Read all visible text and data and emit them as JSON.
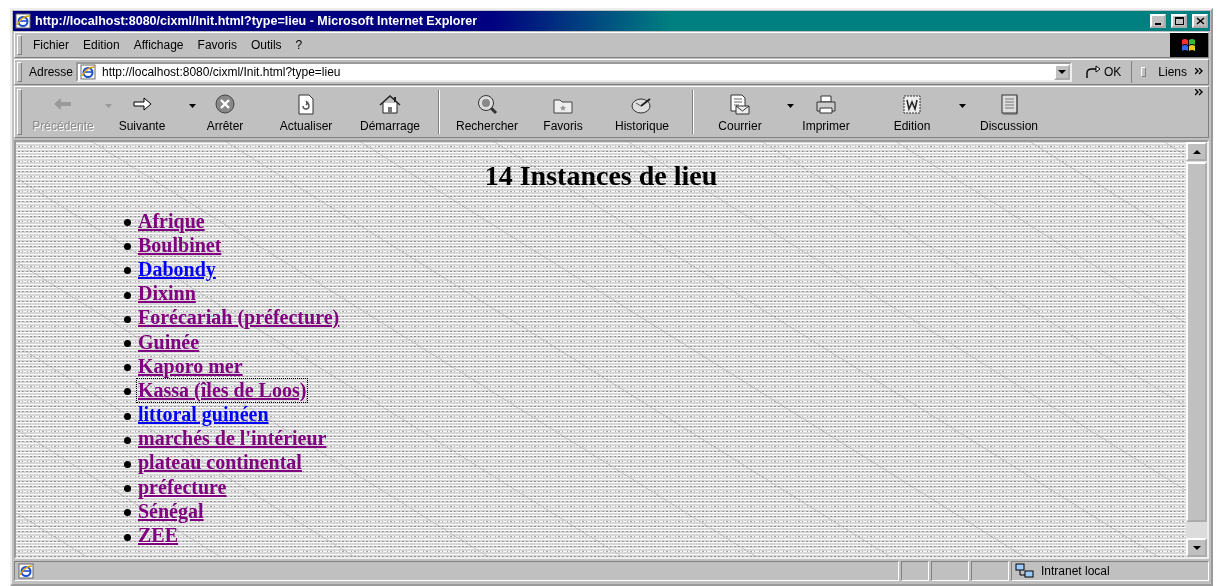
{
  "window": {
    "title": "http://localhost:8080/cixml/Init.html?type=lieu - Microsoft Internet Explorer"
  },
  "menu": [
    {
      "label": "Fichier"
    },
    {
      "label": "Edition"
    },
    {
      "label": "Affichage"
    },
    {
      "label": "Favoris"
    },
    {
      "label": "Outils"
    },
    {
      "label": "?"
    }
  ],
  "address_bar": {
    "label": "Adresse",
    "value": "http://localhost:8080/cixml/Init.html?type=lieu",
    "go_button": "OK",
    "links": "Liens"
  },
  "toolbar": {
    "groups": [
      [
        {
          "kind": "back",
          "label": "Précédente",
          "disabled": true,
          "dropdown": true
        },
        {
          "kind": "forward",
          "label": "Suivante",
          "disabled": false,
          "dropdown": true
        },
        {
          "kind": "stop",
          "label": "Arrêter",
          "disabled": false,
          "dropdown": false
        },
        {
          "kind": "refresh",
          "label": "Actualiser",
          "disabled": false,
          "dropdown": false
        },
        {
          "kind": "home",
          "label": "Démarrage",
          "disabled": false,
          "dropdown": false
        }
      ],
      [
        {
          "kind": "search",
          "label": "Rechercher",
          "disabled": false,
          "dropdown": false
        },
        {
          "kind": "favorites",
          "label": "Favoris",
          "disabled": false,
          "dropdown": false
        },
        {
          "kind": "history",
          "label": "Historique",
          "disabled": false,
          "dropdown": false
        }
      ],
      [
        {
          "kind": "mail",
          "label": "Courrier",
          "disabled": false,
          "dropdown": true
        },
        {
          "kind": "print",
          "label": "Imprimer",
          "disabled": false,
          "dropdown": false
        },
        {
          "kind": "edit",
          "label": "Edition",
          "disabled": false,
          "dropdown": true
        },
        {
          "kind": "discuss",
          "label": "Discussion",
          "disabled": false,
          "dropdown": false
        }
      ]
    ]
  },
  "page": {
    "heading": "14 Instances de lieu",
    "links": [
      {
        "label": "Afrique",
        "visited": true,
        "focused": false
      },
      {
        "label": "Boulbinet",
        "visited": true,
        "focused": false
      },
      {
        "label": "Dabondy",
        "visited": false,
        "focused": false
      },
      {
        "label": "Dixinn",
        "visited": true,
        "focused": false
      },
      {
        "label": "Forécariah (préfecture)",
        "visited": true,
        "focused": false
      },
      {
        "label": "Guinée",
        "visited": true,
        "focused": false
      },
      {
        "label": "Kaporo mer",
        "visited": true,
        "focused": false
      },
      {
        "label": "Kassa (îles de Loos)",
        "visited": true,
        "focused": true
      },
      {
        "label": "littoral guinéen",
        "visited": false,
        "focused": false
      },
      {
        "label": "marchés de l'intérieur",
        "visited": true,
        "focused": false
      },
      {
        "label": "plateau continental",
        "visited": true,
        "focused": false
      },
      {
        "label": "préfecture",
        "visited": true,
        "focused": false
      },
      {
        "label": "Sénégal",
        "visited": true,
        "focused": false
      },
      {
        "label": "ZEE",
        "visited": true,
        "focused": false
      }
    ]
  },
  "status_bar": {
    "zone": "Intranet local"
  }
}
